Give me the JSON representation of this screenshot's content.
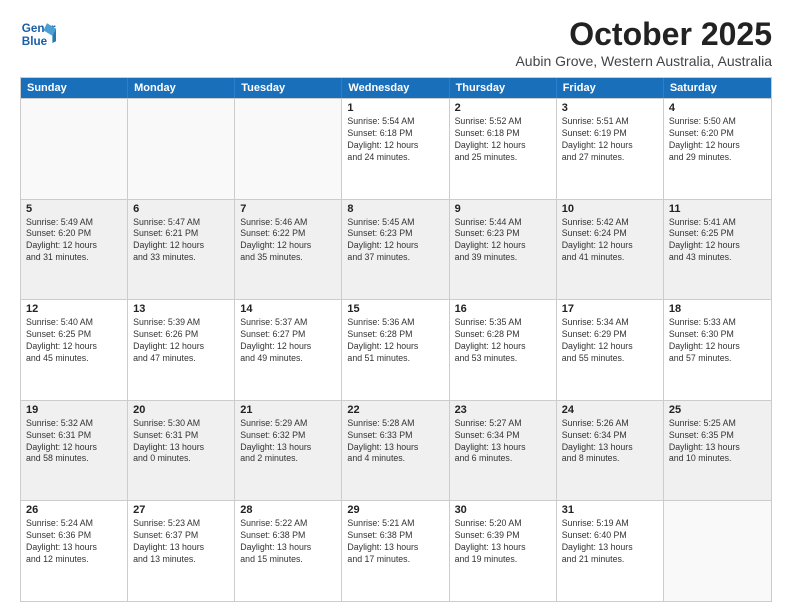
{
  "logo": {
    "line1": "General",
    "line2": "Blue"
  },
  "title": "October 2025",
  "subtitle": "Aubin Grove, Western Australia, Australia",
  "days": [
    "Sunday",
    "Monday",
    "Tuesday",
    "Wednesday",
    "Thursday",
    "Friday",
    "Saturday"
  ],
  "weeks": [
    [
      {
        "day": "",
        "info": ""
      },
      {
        "day": "",
        "info": ""
      },
      {
        "day": "",
        "info": ""
      },
      {
        "day": "1",
        "info": "Sunrise: 5:54 AM\nSunset: 6:18 PM\nDaylight: 12 hours\nand 24 minutes."
      },
      {
        "day": "2",
        "info": "Sunrise: 5:52 AM\nSunset: 6:18 PM\nDaylight: 12 hours\nand 25 minutes."
      },
      {
        "day": "3",
        "info": "Sunrise: 5:51 AM\nSunset: 6:19 PM\nDaylight: 12 hours\nand 27 minutes."
      },
      {
        "day": "4",
        "info": "Sunrise: 5:50 AM\nSunset: 6:20 PM\nDaylight: 12 hours\nand 29 minutes."
      }
    ],
    [
      {
        "day": "5",
        "info": "Sunrise: 5:49 AM\nSunset: 6:20 PM\nDaylight: 12 hours\nand 31 minutes."
      },
      {
        "day": "6",
        "info": "Sunrise: 5:47 AM\nSunset: 6:21 PM\nDaylight: 12 hours\nand 33 minutes."
      },
      {
        "day": "7",
        "info": "Sunrise: 5:46 AM\nSunset: 6:22 PM\nDaylight: 12 hours\nand 35 minutes."
      },
      {
        "day": "8",
        "info": "Sunrise: 5:45 AM\nSunset: 6:23 PM\nDaylight: 12 hours\nand 37 minutes."
      },
      {
        "day": "9",
        "info": "Sunrise: 5:44 AM\nSunset: 6:23 PM\nDaylight: 12 hours\nand 39 minutes."
      },
      {
        "day": "10",
        "info": "Sunrise: 5:42 AM\nSunset: 6:24 PM\nDaylight: 12 hours\nand 41 minutes."
      },
      {
        "day": "11",
        "info": "Sunrise: 5:41 AM\nSunset: 6:25 PM\nDaylight: 12 hours\nand 43 minutes."
      }
    ],
    [
      {
        "day": "12",
        "info": "Sunrise: 5:40 AM\nSunset: 6:25 PM\nDaylight: 12 hours\nand 45 minutes."
      },
      {
        "day": "13",
        "info": "Sunrise: 5:39 AM\nSunset: 6:26 PM\nDaylight: 12 hours\nand 47 minutes."
      },
      {
        "day": "14",
        "info": "Sunrise: 5:37 AM\nSunset: 6:27 PM\nDaylight: 12 hours\nand 49 minutes."
      },
      {
        "day": "15",
        "info": "Sunrise: 5:36 AM\nSunset: 6:28 PM\nDaylight: 12 hours\nand 51 minutes."
      },
      {
        "day": "16",
        "info": "Sunrise: 5:35 AM\nSunset: 6:28 PM\nDaylight: 12 hours\nand 53 minutes."
      },
      {
        "day": "17",
        "info": "Sunrise: 5:34 AM\nSunset: 6:29 PM\nDaylight: 12 hours\nand 55 minutes."
      },
      {
        "day": "18",
        "info": "Sunrise: 5:33 AM\nSunset: 6:30 PM\nDaylight: 12 hours\nand 57 minutes."
      }
    ],
    [
      {
        "day": "19",
        "info": "Sunrise: 5:32 AM\nSunset: 6:31 PM\nDaylight: 12 hours\nand 58 minutes."
      },
      {
        "day": "20",
        "info": "Sunrise: 5:30 AM\nSunset: 6:31 PM\nDaylight: 13 hours\nand 0 minutes."
      },
      {
        "day": "21",
        "info": "Sunrise: 5:29 AM\nSunset: 6:32 PM\nDaylight: 13 hours\nand 2 minutes."
      },
      {
        "day": "22",
        "info": "Sunrise: 5:28 AM\nSunset: 6:33 PM\nDaylight: 13 hours\nand 4 minutes."
      },
      {
        "day": "23",
        "info": "Sunrise: 5:27 AM\nSunset: 6:34 PM\nDaylight: 13 hours\nand 6 minutes."
      },
      {
        "day": "24",
        "info": "Sunrise: 5:26 AM\nSunset: 6:34 PM\nDaylight: 13 hours\nand 8 minutes."
      },
      {
        "day": "25",
        "info": "Sunrise: 5:25 AM\nSunset: 6:35 PM\nDaylight: 13 hours\nand 10 minutes."
      }
    ],
    [
      {
        "day": "26",
        "info": "Sunrise: 5:24 AM\nSunset: 6:36 PM\nDaylight: 13 hours\nand 12 minutes."
      },
      {
        "day": "27",
        "info": "Sunrise: 5:23 AM\nSunset: 6:37 PM\nDaylight: 13 hours\nand 13 minutes."
      },
      {
        "day": "28",
        "info": "Sunrise: 5:22 AM\nSunset: 6:38 PM\nDaylight: 13 hours\nand 15 minutes."
      },
      {
        "day": "29",
        "info": "Sunrise: 5:21 AM\nSunset: 6:38 PM\nDaylight: 13 hours\nand 17 minutes."
      },
      {
        "day": "30",
        "info": "Sunrise: 5:20 AM\nSunset: 6:39 PM\nDaylight: 13 hours\nand 19 minutes."
      },
      {
        "day": "31",
        "info": "Sunrise: 5:19 AM\nSunset: 6:40 PM\nDaylight: 13 hours\nand 21 minutes."
      },
      {
        "day": "",
        "info": ""
      }
    ]
  ]
}
